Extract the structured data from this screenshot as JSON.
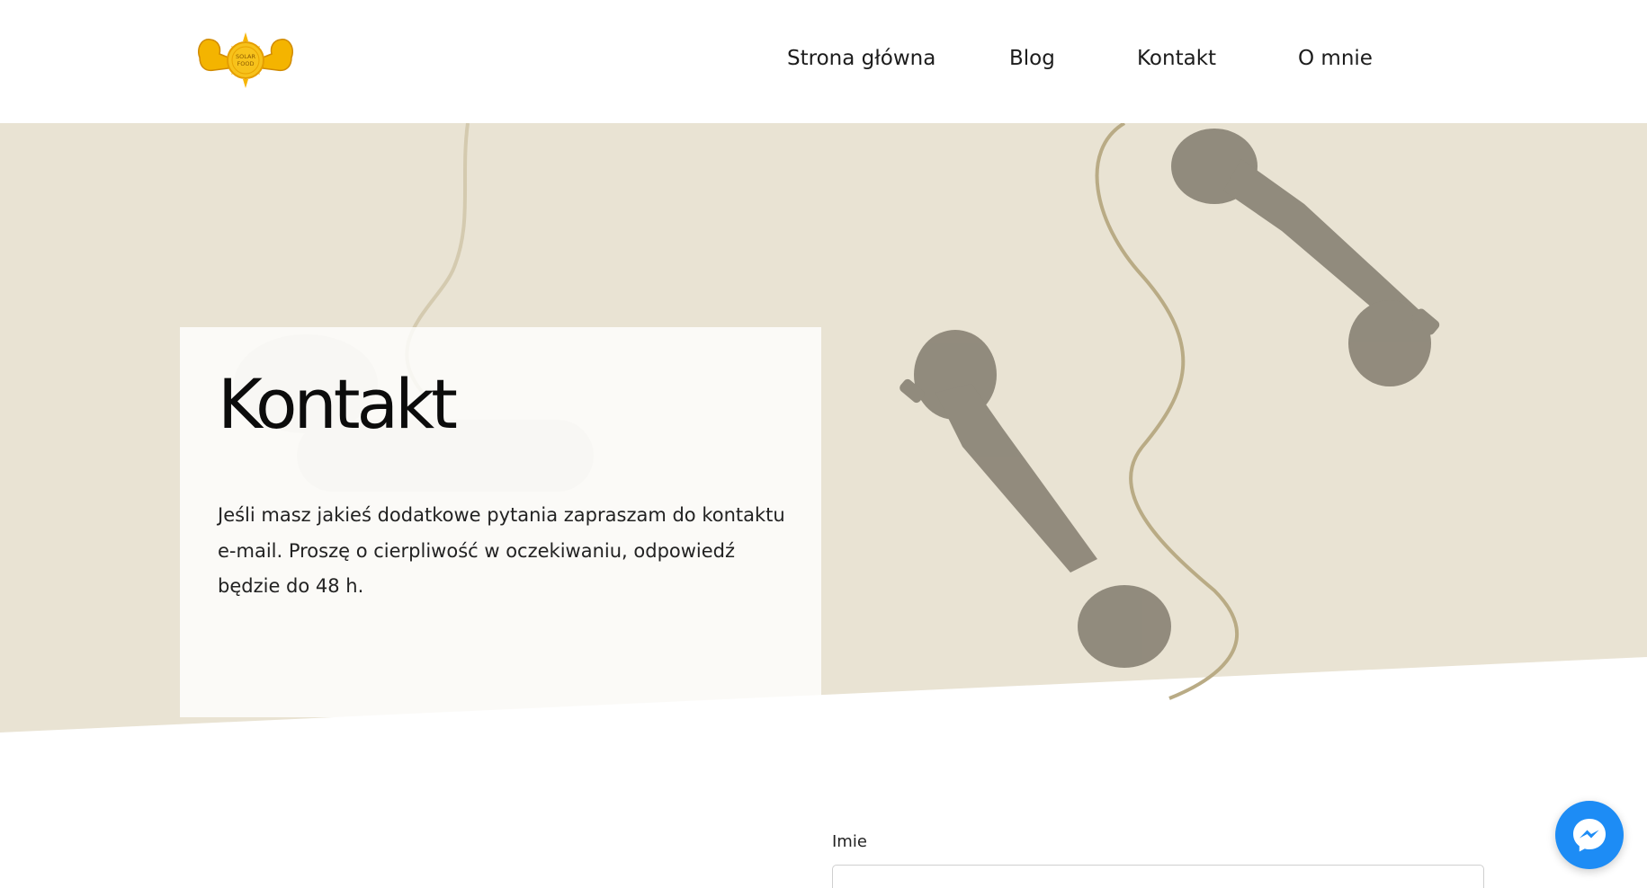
{
  "header": {
    "logo_text_line1": "SOLAR",
    "logo_text_line2": "FOOD",
    "nav": [
      {
        "label": "Strona główna"
      },
      {
        "label": "Blog"
      },
      {
        "label": "Kontakt"
      },
      {
        "label": "O mnie"
      }
    ]
  },
  "hero": {
    "title": "Kontakt",
    "description": "Jeśli masz jakieś dodatkowe pytania zapraszam do kontaktu e-mail. Proszę o cierpliwość w oczekiwaniu, odpowiedź będzie do 48 h."
  },
  "form": {
    "name_label": "Imie",
    "name_value": ""
  },
  "messenger": {
    "icon": "messenger-icon"
  },
  "colors": {
    "hero_background": "#e9e3d3",
    "messenger_blue": "#1d8cf5",
    "logo_yellow": "#f7c21b"
  }
}
